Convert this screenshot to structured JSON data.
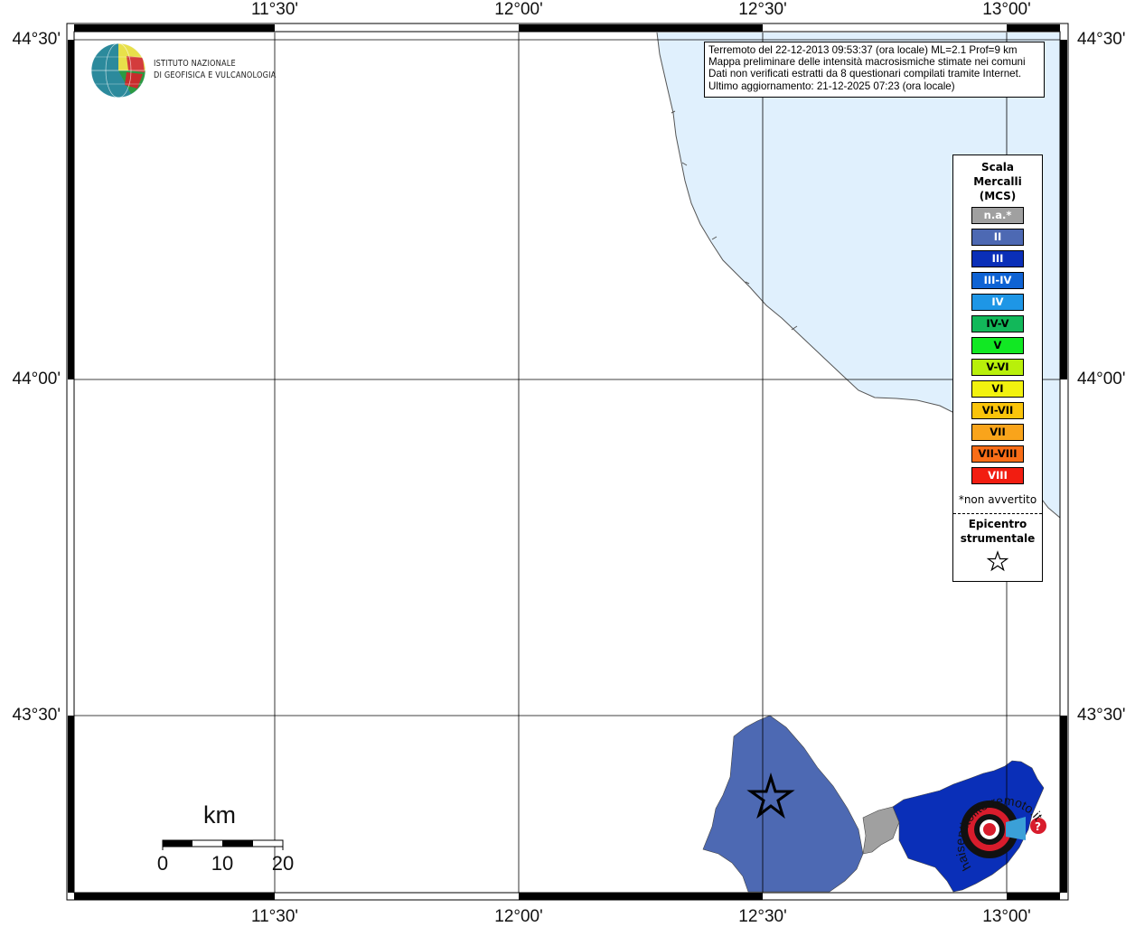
{
  "map": {
    "lon_labels_top": [
      "11°30'",
      "12°00'",
      "12°30'",
      "13°00'"
    ],
    "lon_labels_bottom": [
      "11°30'",
      "12°00'",
      "12°30'",
      "13°00'"
    ],
    "lat_labels_left": [
      "44°30'",
      "44°00'",
      "43°30'"
    ],
    "lat_labels_right": [
      "44°30'",
      "44°00'",
      "43°30'"
    ],
    "sea_color": "#e0f0fd",
    "land_color": "#ffffff",
    "grid_color": "#000000"
  },
  "logo": {
    "line1": "ISTITUTO NAZIONALE",
    "line2": "DI GEOFISICA E VULCANOLOGIA"
  },
  "info": {
    "line1": "Terremoto del 22-12-2013 09:53:37 (ora locale) ML=2.1 Prof=9 km",
    "line2": "Mappa preliminare delle intensità macrosismiche stimate nei comuni",
    "line3": "Dati non verificati estratti da 8 questionari compilati tramite Internet.",
    "line4": "Ultimo aggiornamento: 21-12-2025 07:23 (ora locale)"
  },
  "legend": {
    "title1": "Scala",
    "title2": "Mercalli",
    "title3": "(MCS)",
    "items": [
      {
        "label": "n.a.*",
        "color": "#a0a0a0",
        "text_color": "#ffffff"
      },
      {
        "label": "II",
        "color": "#4d69b3",
        "text_color": "#ffffff"
      },
      {
        "label": "III",
        "color": "#0a2fb8",
        "text_color": "#ffffff"
      },
      {
        "label": "III-IV",
        "color": "#0f63d4",
        "text_color": "#ffffff"
      },
      {
        "label": "IV",
        "color": "#1e96e6",
        "text_color": "#ffffff"
      },
      {
        "label": "IV-V",
        "color": "#12b85a",
        "text_color": "#000000"
      },
      {
        "label": "V",
        "color": "#11e823",
        "text_color": "#000000"
      },
      {
        "label": "V-VI",
        "color": "#b8f00a",
        "text_color": "#000000"
      },
      {
        "label": "VI",
        "color": "#f2f20f",
        "text_color": "#000000"
      },
      {
        "label": "VI-VII",
        "color": "#fac40a",
        "text_color": "#000000"
      },
      {
        "label": "VII",
        "color": "#f9a41b",
        "text_color": "#000000"
      },
      {
        "label": "VII-VIII",
        "color": "#f86d17",
        "text_color": "#000000"
      },
      {
        "label": "VIII",
        "color": "#f21d11",
        "text_color": "#ffffff"
      }
    ],
    "note": "*non avvertito",
    "epicenter1": "Epicentro",
    "epicenter2": "strumentale"
  },
  "scalebar": {
    "unit": "km",
    "labels": [
      "0",
      "10",
      "20"
    ]
  },
  "watermark": {
    "text": "haisentitoilterremoto.it"
  }
}
